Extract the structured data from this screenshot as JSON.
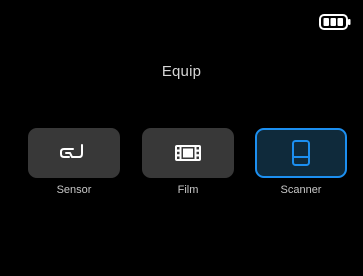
{
  "screen": {
    "title": "Equip"
  },
  "status": {
    "battery_icon": "battery-full-icon",
    "battery_level": 1.0
  },
  "menu": {
    "items": [
      {
        "label": "Sensor",
        "icon": "sensor-icon",
        "selected": false
      },
      {
        "label": "Film",
        "icon": "film-icon",
        "selected": false
      },
      {
        "label": "Scanner",
        "icon": "scanner-icon",
        "selected": true
      }
    ]
  },
  "colors": {
    "background": "#000000",
    "tile": "#383838",
    "accent": "#1c8ff0",
    "text": "#c7c7c7"
  }
}
